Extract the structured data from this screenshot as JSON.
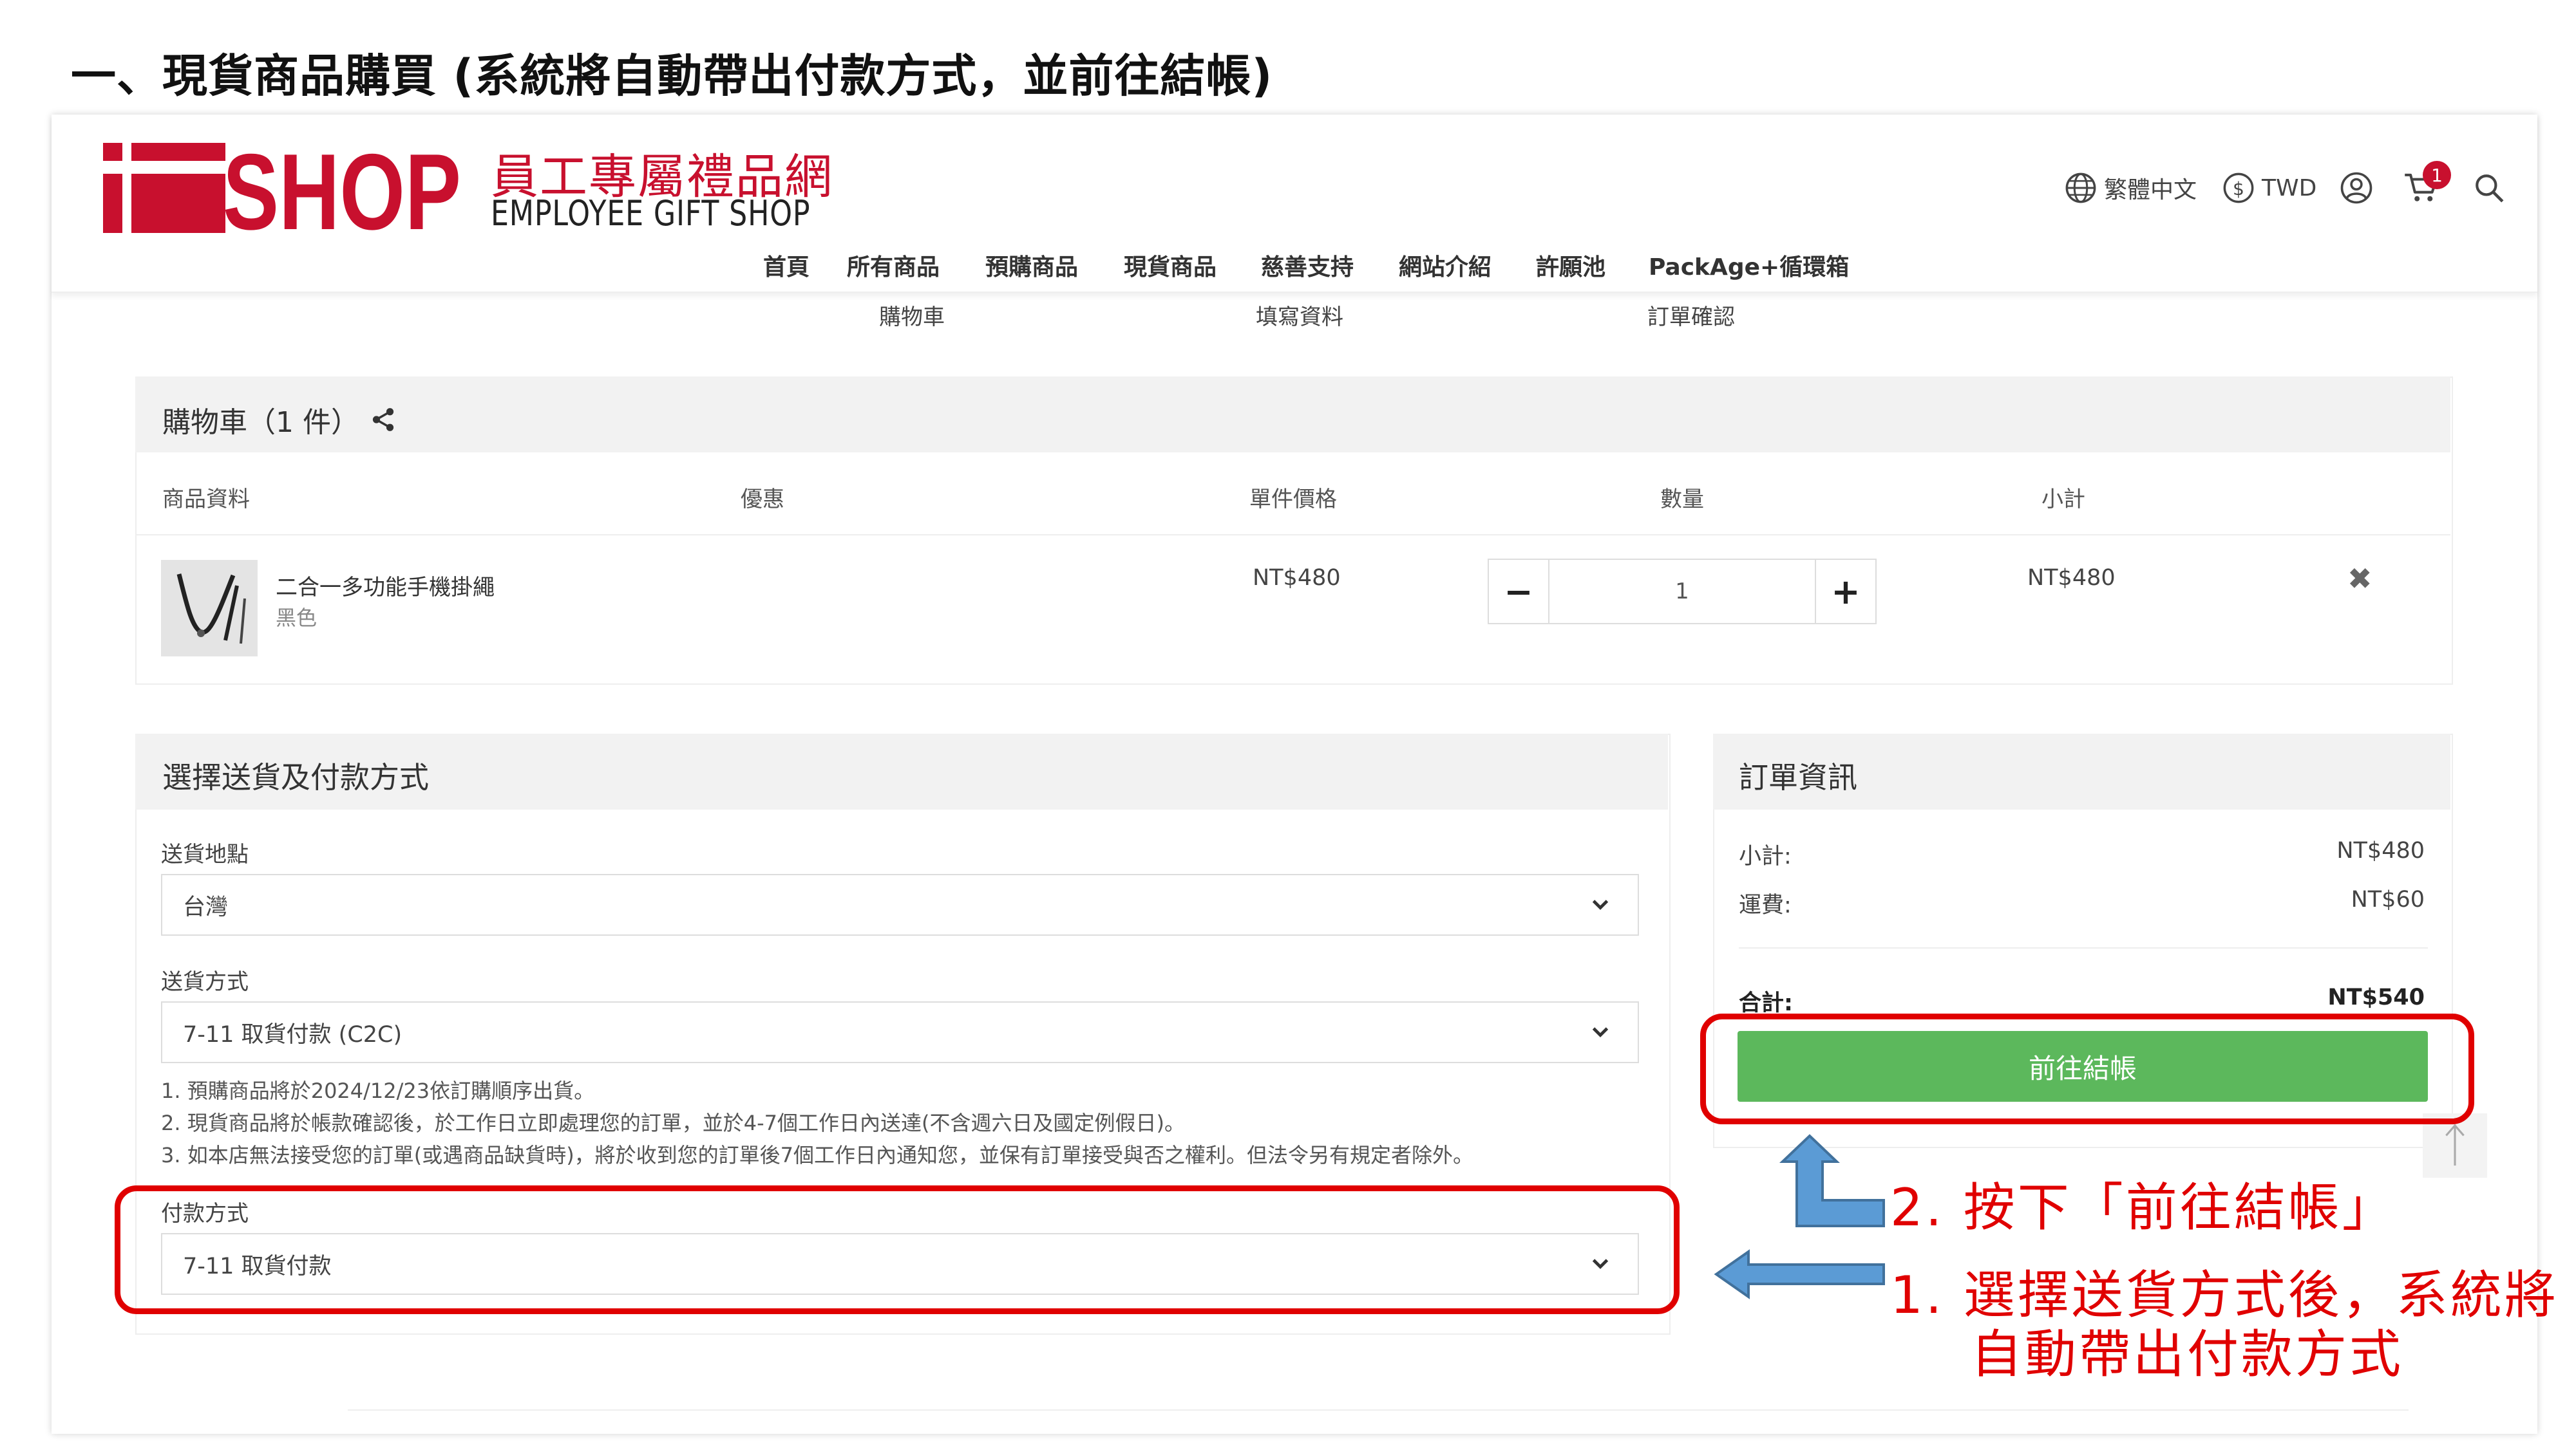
{
  "doc_heading": "一、現貨商品購買 (系統將自動帶出付款方式，並前往結帳)",
  "site": {
    "logo_text": "i SHOP",
    "logo_cn": "員工專屬禮品網",
    "logo_en": "EMPLOYEE GIFT SHOP",
    "language": "繁體中文",
    "currency": "TWD",
    "cart_badge": "1",
    "nav": [
      "首頁",
      "所有商品",
      "預購商品",
      "現貨商品",
      "慈善支持",
      "網站介紹",
      "許願池",
      "PackAge+循環箱"
    ]
  },
  "steps": [
    "購物車",
    "填寫資料",
    "訂單確認"
  ],
  "cart": {
    "title": "購物車（1 件）",
    "columns": [
      "商品資料",
      "優惠",
      "單件價格",
      "數量",
      "小計"
    ],
    "item": {
      "name": "二合一多功能手機掛繩",
      "variant": "黑色",
      "unit_price": "NT$480",
      "quantity": "1",
      "subtotal": "NT$480",
      "minus": "−",
      "plus": "+",
      "remove": "✖"
    }
  },
  "shipping": {
    "title": "選擇送貨及付款方式",
    "location_label": "送貨地點",
    "location_value": "台灣",
    "method_label": "送貨方式",
    "method_value": "7-11 取貨付款 (C2C)",
    "notes": [
      "1. 預購商品將於2024/12/23依訂購順序出貨。",
      "2. 現貨商品將於帳款確認後，於工作日立即處理您的訂單，並於4-7個工作日內送達(不含週六日及國定例假日)。",
      "3. 如本店無法接受您的訂單(或遇商品缺貨時)，將於收到您的訂單後7個工作日內通知您，並保有訂單接受與否之權利。但法令另有規定者除外。"
    ],
    "payment_label": "付款方式",
    "payment_value": "7-11 取貨付款"
  },
  "order": {
    "title": "訂單資訊",
    "subtotal_label": "小計:",
    "subtotal_value": "NT$480",
    "shipping_label": "運費:",
    "shipping_value": "NT$60",
    "total_label": "合計:",
    "total_value": "NT$540",
    "checkout_label": "前往結帳"
  },
  "annotations": {
    "step2": "2.  按下「前往結帳」",
    "step1_line1": "1.  選擇送貨方式後，系統將",
    "step1_line2": "自動帶出付款方式"
  },
  "colors": {
    "brand_red": "#c8102e",
    "checkout_green": "#5cb85c",
    "annotation_red": "#e00000",
    "arrow_blue": "#5b9bd5"
  }
}
